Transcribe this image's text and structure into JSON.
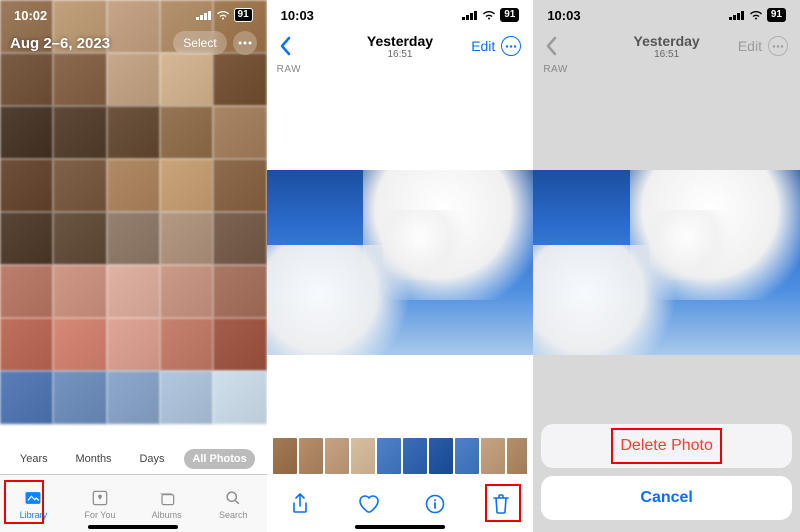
{
  "phone1": {
    "status_time": "10:02",
    "date_range": "Aug 2–6, 2023",
    "select_btn": "Select",
    "segments": [
      "Years",
      "Months",
      "Days",
      "All Photos"
    ],
    "active_segment": 3,
    "tabs": [
      {
        "label": "Library"
      },
      {
        "label": "For You"
      },
      {
        "label": "Albums"
      },
      {
        "label": "Search"
      }
    ],
    "active_tab": 0
  },
  "phone2": {
    "status_time": "10:03",
    "nav_title": "Yesterday",
    "nav_sub": "16:51",
    "edit_label": "Edit",
    "raw_badge": "RAW"
  },
  "phone3": {
    "status_time": "10:03",
    "nav_title": "Yesterday",
    "nav_sub": "16:51",
    "edit_label": "Edit",
    "raw_badge": "RAW",
    "delete_label": "Delete Photo",
    "cancel_label": "Cancel"
  },
  "battery": "91",
  "thumb_colors": [
    "#9c7a5c",
    "#c2a27d",
    "#c6a588",
    "#b5936f",
    "#a37d56",
    "#7a5d44",
    "#8b6a4f",
    "#c7a88a",
    "#d6b894",
    "#7c5a3d",
    "#524033",
    "#5f4a39",
    "#6e5540",
    "#977656",
    "#a98665",
    "#6f503a",
    "#80624a",
    "#b18b66",
    "#caa47b",
    "#8e6c4d",
    "#5a4636",
    "#6b5543",
    "#968070",
    "#b49984",
    "#7e6452",
    "#bc7f6e",
    "#d09886",
    "#e0b2a3",
    "#cb9a89",
    "#aa7865",
    "#c0705e",
    "#d68977",
    "#dfa596",
    "#c7826f",
    "#a55e4c",
    "#5a7eb7",
    "#7594c0",
    "#8ea9cc",
    "#b3c7de",
    "#cfe0ec"
  ],
  "filmstrip_colors": [
    "#a27b56",
    "#b58f6b",
    "#c6a382",
    "#d8bfa0",
    "#4e82c8",
    "#3a6eb8",
    "#2a5da8",
    "#4e82c8",
    "#c6a382",
    "#b58f6b"
  ]
}
